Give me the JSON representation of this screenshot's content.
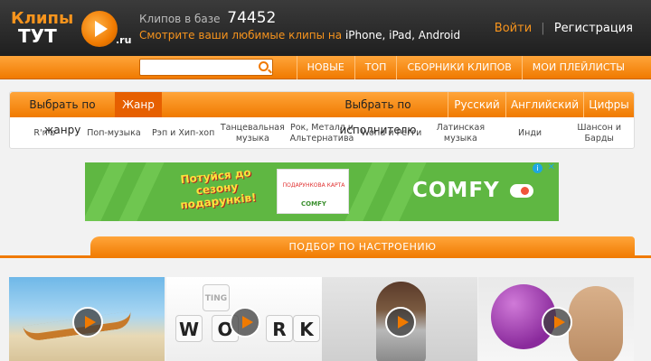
{
  "header": {
    "logo_line1": "Клипы",
    "logo_line2": "ТУТ",
    "logo_suffix": ".ru",
    "count_label": "Клипов в базе",
    "count_value": "74452",
    "tagline": "Смотрите ваши любимые клипы на",
    "devices": "iPhone, iPad, Android",
    "login": "Войти",
    "separator": "|",
    "register": "Регистрация"
  },
  "nav": {
    "search_placeholder": "",
    "items": [
      "Новые",
      "Топ",
      "Сборники клипов",
      "Мои плейлисты"
    ]
  },
  "genre_panel": {
    "tab_by_genre": "Выбрать по жанру",
    "tab_genre_active": "Жанр",
    "tab_by_artist": "Выбрать по исполнителю",
    "tab_russian": "Русский",
    "tab_english": "Английский",
    "tab_digits": "Цифры",
    "genres": [
      "R'n'b",
      "Поп-музыка",
      "Рэп и Хип-хоп",
      "Танцевальная музыка",
      "Рок, Металл и Альтернатива",
      "World и Регги",
      "Латинская музыка",
      "Инди",
      "Шансон и Барды"
    ]
  },
  "ad": {
    "promo_text": "Потуйся до сезону подарунків!",
    "card_text": "ПОДАРУНКОВА КАРТА",
    "card_brand": "COMFY",
    "brand": "COMFY",
    "info_icon": "i",
    "close_icon": "✕"
  },
  "mood": {
    "title": "Подбор по настроению"
  },
  "thumbnails": {
    "work_letters": [
      "W",
      "O",
      "R",
      "K"
    ],
    "work_top": "TING"
  },
  "colors": {
    "accent": "#f07a00",
    "header_bg": "#2b2b2b",
    "ad_green": "#5fb742"
  }
}
